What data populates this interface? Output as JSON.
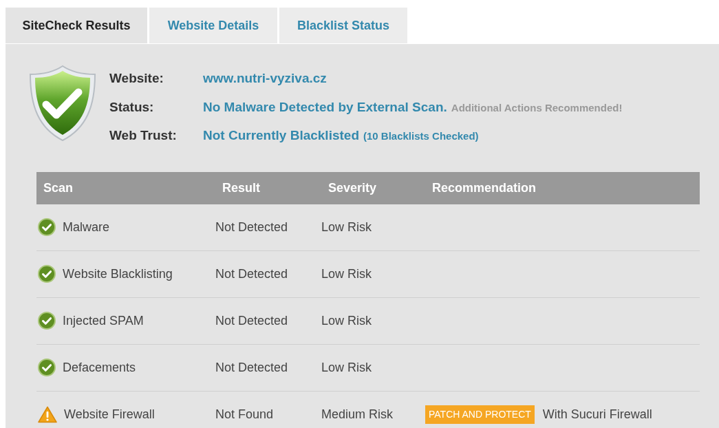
{
  "tabs": [
    {
      "label": "SiteCheck Results",
      "selected": true
    },
    {
      "label": "Website Details",
      "selected": false
    },
    {
      "label": "Blacklist Status",
      "selected": false
    }
  ],
  "summary": {
    "rows": [
      {
        "label": "Website:",
        "value": "www.nutri-vyziva.cz"
      },
      {
        "label": "Status:",
        "value": "No Malware Detected by External Scan.",
        "note": "Additional Actions Recommended!",
        "kind": "muted"
      },
      {
        "label": "Web Trust:",
        "value": "Not Currently Blacklisted",
        "note": "(10 Blacklists Checked)",
        "kind": "link"
      }
    ]
  },
  "table": {
    "columns": [
      "Scan",
      "Result",
      "Severity",
      "Recommendation"
    ],
    "rows": [
      {
        "kind": "ok",
        "scan": "Malware",
        "result": "Not Detected",
        "severity": "Low Risk"
      },
      {
        "kind": "ok",
        "scan": "Website Blacklisting",
        "result": "Not Detected",
        "severity": "Low Risk"
      },
      {
        "kind": "ok",
        "scan": "Injected SPAM",
        "result": "Not Detected",
        "severity": "Low Risk"
      },
      {
        "kind": "ok",
        "scan": "Defacements",
        "result": "Not Detected",
        "severity": "Low Risk"
      },
      {
        "kind": "warning",
        "scan": "Website Firewall",
        "result": "Not Found",
        "severity": "Medium Risk",
        "recommendation": {
          "badge": "PATCH AND PROTECT",
          "text": "With Sucuri Firewall"
        }
      }
    ]
  }
}
